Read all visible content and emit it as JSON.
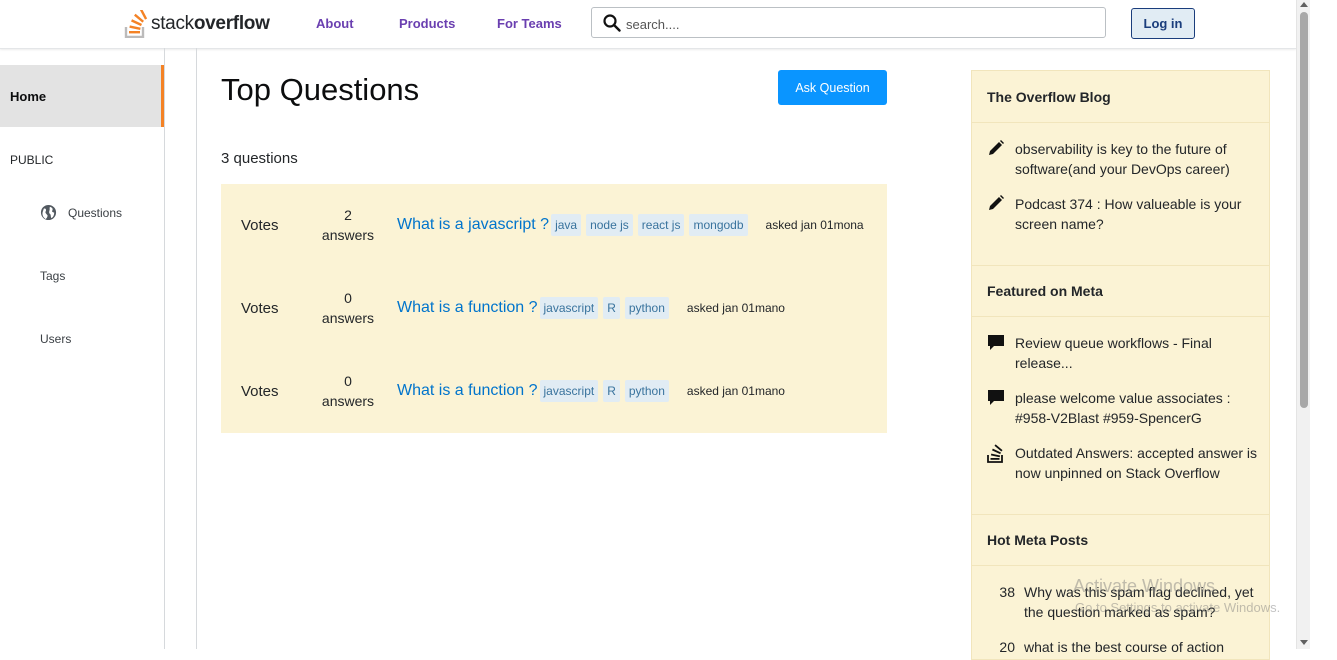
{
  "header": {
    "logo": {
      "text_light": "stack",
      "text_bold": "overflow"
    },
    "nav": [
      "About",
      "Products",
      "For Teams"
    ],
    "search_placeholder": "search....",
    "login_label": "Log in"
  },
  "sidebar": {
    "home": "Home",
    "public_label": "PUBLIC",
    "questions": "Questions",
    "tags": "Tags",
    "users": "Users"
  },
  "main": {
    "title": "Top Questions",
    "ask_button": "Ask Question",
    "count": "3 questions",
    "questions": [
      {
        "votes": "Votes",
        "answers_count": "2",
        "answers_label": "answers",
        "title": "What is a javascript ?",
        "tags": [
          "java",
          "node js",
          "react js",
          "mongodb"
        ],
        "asked": "asked jan 01mona"
      },
      {
        "votes": "Votes",
        "answers_count": "0",
        "answers_label": "answers",
        "title": "What is a function ?",
        "tags": [
          "javascript",
          "R",
          "python"
        ],
        "asked": "asked jan 01mano"
      },
      {
        "votes": "Votes",
        "answers_count": "0",
        "answers_label": "answers",
        "title": "What is a function ?",
        "tags": [
          "javascript",
          "R",
          "python"
        ],
        "asked": "asked jan 01mano"
      }
    ]
  },
  "right": {
    "blog_title": "The Overflow Blog",
    "blog_items": [
      {
        "icon": "pencil-icon",
        "text": "observability is key to the future of software(and your DevOps career)"
      },
      {
        "icon": "pencil-icon",
        "text": "Podcast 374 : How valueable is your screen name?"
      }
    ],
    "meta_title": "Featured on Meta",
    "meta_items": [
      {
        "icon": "comment-icon",
        "text": "Review queue workflows - Final release..."
      },
      {
        "icon": "comment-icon",
        "text": "please welcome value associates : #958-V2Blast #959-SpencerG"
      },
      {
        "icon": "stackoverflow-icon",
        "text": "Outdated Answers: accepted answer is now unpinned on Stack Overflow"
      }
    ],
    "hot_title": "Hot Meta Posts",
    "hot_items": [
      {
        "num": "38",
        "text": "Why was this spam flag declined, yet the question marked as spam?"
      },
      {
        "num": "20",
        "text": "what is the best course of action"
      }
    ]
  },
  "watermark": {
    "line1": "Activate Windows",
    "line2": "Go to Settings to activate Windows."
  },
  "colors": {
    "accent": "#f48225",
    "link": "#0074cc",
    "nav": "#6a3fb0",
    "button": "#0a95ff",
    "panel": "#fbf3d5"
  }
}
